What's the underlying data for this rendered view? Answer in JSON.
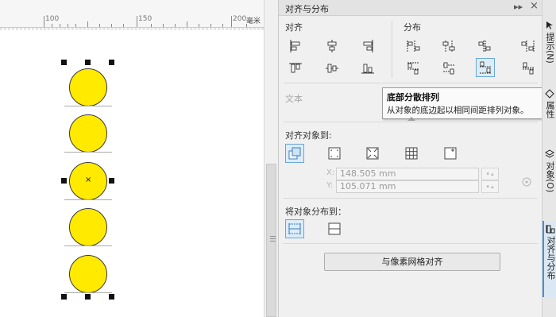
{
  "ruler": {
    "ticks": [
      "100",
      "150",
      "200"
    ],
    "unit": "毫米"
  },
  "docker": {
    "title": "对齐与分布",
    "controls": {
      "pin": "▸▸",
      "close": "×"
    },
    "align_label": "对齐",
    "distribute_label": "分布",
    "align_icons": [
      "align-left-icon",
      "align-center-horizontal-icon",
      "align-right-icon",
      "align-top-icon",
      "align-center-vertical-icon",
      "align-bottom-icon"
    ],
    "distribute_icons": [
      "distribute-left-icon",
      "distribute-center-horizontal-icon",
      "distribute-spacing-horizontal-icon",
      "distribute-right-icon",
      "distribute-top-icon",
      "distribute-center-vertical-icon",
      "distribute-bottom-icon",
      "distribute-spacing-vertical-icon"
    ],
    "active_icon": "distribute-bottom-icon",
    "text_label": "文本",
    "align_to_label": "对齐对象到:",
    "align_to_icons": [
      "active-object-icon",
      "page-edges-icon",
      "page-center-icon",
      "grid-icon",
      "specified-point-icon"
    ],
    "x_label": "X:",
    "x_value": "148.505 mm",
    "y_label": "Y:",
    "y_value": "105.071 mm",
    "distribute_to_label": "将对象分布到：",
    "distribute_to_icons": [
      "selection-extent-icon",
      "page-extent-icon"
    ],
    "snap_button": "与像素网格对齐"
  },
  "tooltip": {
    "title": "底部分散排列",
    "description": "从对象的底边起以相同间距排列对象。"
  },
  "side_tabs": [
    {
      "label": "提示(N)",
      "icon": "hint-icon"
    },
    {
      "label": "属性",
      "icon": "properties-icon"
    },
    {
      "label": "对象(O)",
      "icon": "objects-icon"
    },
    {
      "label": "对齐与分布",
      "icon": "align-distribute-icon"
    }
  ],
  "colors": {
    "circle_fill": "#ffea00",
    "accent": "#4a90d0"
  }
}
